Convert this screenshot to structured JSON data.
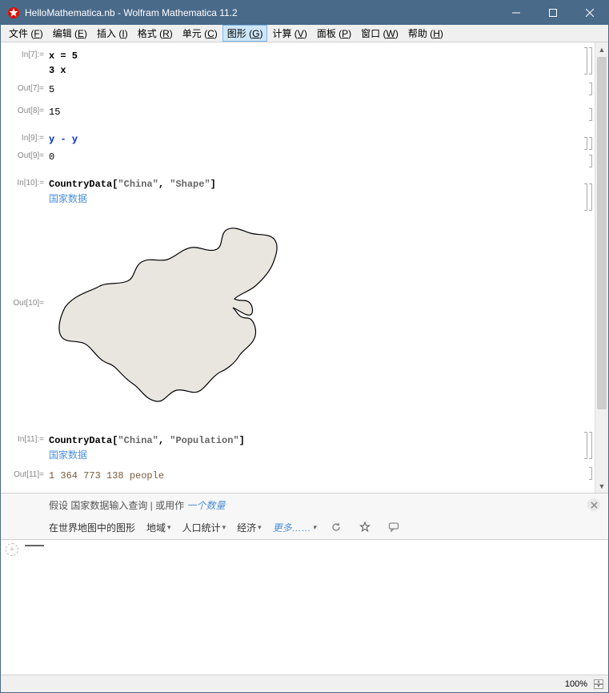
{
  "titlebar": {
    "title": "HelloMathematica.nb - Wolfram Mathematica 11.2"
  },
  "menu": [
    {
      "label": "文件",
      "key": "F"
    },
    {
      "label": "编辑",
      "key": "E"
    },
    {
      "label": "插入",
      "key": "I"
    },
    {
      "label": "格式",
      "key": "R"
    },
    {
      "label": "单元",
      "key": "C"
    },
    {
      "label": "图形",
      "key": "G",
      "active": true
    },
    {
      "label": "计算",
      "key": "V"
    },
    {
      "label": "面板",
      "key": "P"
    },
    {
      "label": "窗口",
      "key": "W"
    },
    {
      "label": "帮助",
      "key": "H"
    }
  ],
  "cells": {
    "in7_label": "In[7]:=",
    "in7_l1": "x = 5",
    "in7_l2": "3 x",
    "out7_label": "Out[7]=",
    "out7": "5",
    "out8_label": "Out[8]=",
    "out8": "15",
    "in9_label": "In[9]:=",
    "in9_y": "y",
    "in9_op": " - ",
    "in9_y2": "y",
    "out9_label": "Out[9]=",
    "out9": "0",
    "in10_label": "In[10]:=",
    "in10_fn": "CountryData",
    "in10_b1": "[",
    "in10_s1": "\"China\"",
    "in10_c": ", ",
    "in10_s2": "\"Shape\"",
    "in10_b2": "]",
    "in10_link": "国家数据",
    "out10_label": "Out[10]=",
    "in11_label": "In[11]:=",
    "in11_fn": "CountryData",
    "in11_b1": "[",
    "in11_s1": "\"China\"",
    "in11_c": ", ",
    "in11_s2": "\"Population\"",
    "in11_b2": "]",
    "in11_link": "国家数据",
    "out11_label": "Out[11]=",
    "out11": "1 364 773 138 people"
  },
  "suggest": {
    "row1_prefix": "假设 国家数据输入查询 | 或用作 ",
    "row1_link": "一个数量",
    "btn_shape": "在世界地图中的图形",
    "btn_region": "地域",
    "btn_pop": "人口统计",
    "btn_econ": "经济",
    "btn_more": "更多……"
  },
  "status": {
    "zoom": "100%"
  }
}
